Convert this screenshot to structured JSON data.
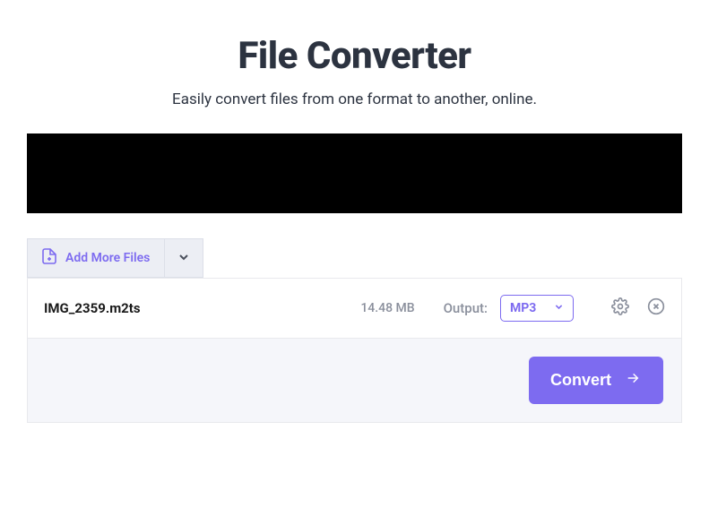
{
  "header": {
    "title": "File Converter",
    "subtitle": "Easily convert files from one format to another, online."
  },
  "toolbar": {
    "add_more_label": "Add More Files"
  },
  "file": {
    "name": "IMG_2359.m2ts",
    "size": "14.48 MB",
    "output_label": "Output:",
    "output_format": "MP3"
  },
  "actions": {
    "convert_label": "Convert"
  },
  "colors": {
    "accent": "#7d6bf0",
    "dark": "#2c3340",
    "muted": "#8a8f9c",
    "light_bg": "#eceef4",
    "panel_bg": "#f5f6fa"
  }
}
